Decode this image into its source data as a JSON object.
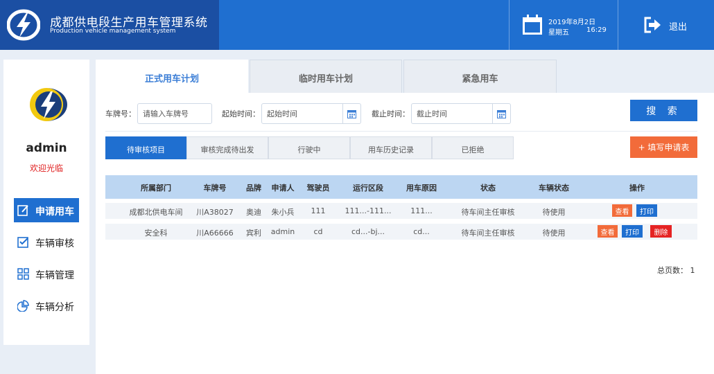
{
  "header": {
    "title_cn": "成都供电段生产用车管理系统",
    "title_en": "Production vehicle management system",
    "date": "2019年8月2日",
    "weekday": "星期五",
    "time": "16:29",
    "logout_label": "退出"
  },
  "sidebar": {
    "username": "admin",
    "welcome": "欢迎光临",
    "items": [
      {
        "label": "申请用车",
        "icon": "edit-icon",
        "active": true
      },
      {
        "label": "车辆审核",
        "icon": "checkbox-icon",
        "active": false
      },
      {
        "label": "车辆管理",
        "icon": "grid-icon",
        "active": false
      },
      {
        "label": "车辆分析",
        "icon": "pie-chart-icon",
        "active": false
      }
    ]
  },
  "main_tabs": [
    {
      "label": "正式用车计划",
      "active": true
    },
    {
      "label": "临时用车计划",
      "active": false
    },
    {
      "label": "紧急用车",
      "active": false
    }
  ],
  "filters": {
    "plate_label": "车牌号：",
    "plate_placeholder": "请输入车牌号",
    "start_label": "起始时间：",
    "start_placeholder": "起始时间",
    "end_label": "截止时间：",
    "end_placeholder": "截止时间",
    "search_label": "搜 索"
  },
  "sub_tabs": [
    {
      "label": "待审核项目",
      "active": true
    },
    {
      "label": "审核完成待出发",
      "active": false
    },
    {
      "label": "行驶中",
      "active": false
    },
    {
      "label": "用车历史记录",
      "active": false
    },
    {
      "label": "已拒绝",
      "active": false
    }
  ],
  "apply_label": "+ 填写申请表",
  "table": {
    "columns": [
      "所属部门",
      "车牌号",
      "品牌",
      "申请人",
      "驾驶员",
      "运行区段",
      "用车原因",
      "状态",
      "车辆状态",
      "操作"
    ],
    "rows": [
      {
        "cells": [
          "成都北供电车间",
          "川A38027",
          "奥迪",
          "朱小兵",
          "111",
          "111...-111...",
          "111...",
          "待车间主任审核",
          "待使用"
        ],
        "actions": [
          "查看",
          "打印"
        ]
      },
      {
        "cells": [
          "安全科",
          "川A66666",
          "宾利",
          "admin",
          "cd",
          "cd...-bj...",
          "cd...",
          "待车间主任审核",
          "待使用"
        ],
        "actions": [
          "查看",
          "打印",
          "删除"
        ]
      }
    ]
  },
  "pagination": {
    "total_label": "总页数： 1"
  },
  "colors": {
    "primary": "#1f6fd0",
    "header_dark": "#1b4fa3",
    "orange": "#f26b3a",
    "red": "#e52323",
    "table_head": "#bcd6f2"
  }
}
